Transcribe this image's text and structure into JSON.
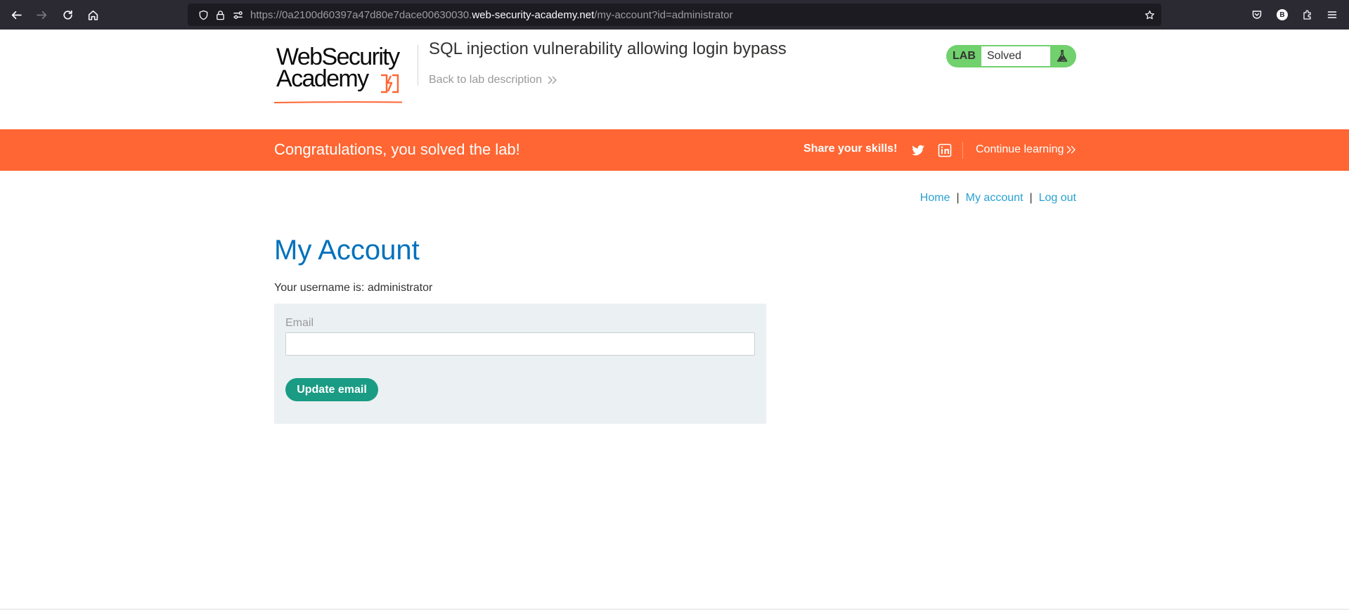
{
  "browser": {
    "url_prefix": "https://0a2100d60397a47d80e7dace00630030.",
    "url_domain": "web-security-academy.net",
    "url_path": "/my-account?id=administrator",
    "profile_initial": "B"
  },
  "logo": {
    "line1": "WebSecurity",
    "line2": "Academy",
    "accent_color": "#ff6633"
  },
  "lab": {
    "title": "SQL injection vulnerability allowing login bypass",
    "back_link": "Back to lab description",
    "status_label": "LAB",
    "status_value": "Solved",
    "status_color": "#70d16d"
  },
  "banner": {
    "message": "Congratulations, you solved the lab!",
    "share": "Share your skills!",
    "continue": "Continue learning",
    "color": "#ff6633"
  },
  "nav": {
    "home": "Home",
    "my_account": "My account",
    "log_out": "Log out",
    "separator": "|"
  },
  "account": {
    "heading": "My Account",
    "username_text": "Your username is: administrator",
    "email_label": "Email",
    "email_value": "",
    "update_button": "Update email"
  },
  "icons": {
    "back": "arrow-left-icon",
    "forward": "arrow-right-icon",
    "reload": "reload-icon",
    "home": "home-icon",
    "shield": "shield-icon",
    "lock": "lock-icon",
    "permissions": "permissions-icon",
    "bookmark": "star-icon",
    "pocket": "pocket-icon",
    "extensions": "puzzle-icon",
    "menu": "hamburger-menu-icon",
    "twitter": "twitter-icon",
    "linkedin": "linkedin-icon",
    "flask": "flask-icon"
  }
}
